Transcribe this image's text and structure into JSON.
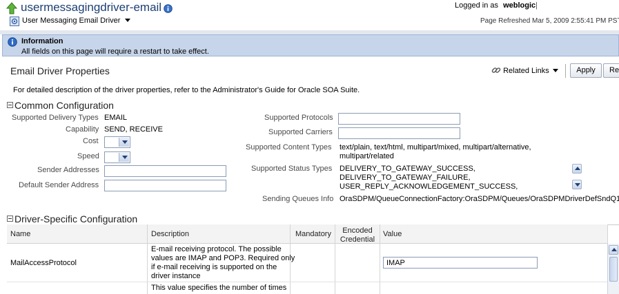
{
  "header": {
    "title": "usermessagingdriver-email",
    "menu_label": "User Messaging Email Driver",
    "logged_in_prefix": "Logged in as",
    "username": "weblogic",
    "refreshed": "Page Refreshed Mar 5, 2009 2:55:41 PM PST"
  },
  "info": {
    "title": "Information",
    "message": "All fields on this page will require a restart to take effect."
  },
  "page": {
    "title": "Email Driver Properties",
    "related_links": "Related Links",
    "apply": "Apply",
    "revert": "Re",
    "description": "For detailed description of the driver properties, refer to the Administrator's Guide for Oracle SOA Suite."
  },
  "common": {
    "title": "Common Configuration",
    "supported_delivery_types_label": "Supported Delivery Types",
    "supported_delivery_types": "EMAIL",
    "capability_label": "Capability",
    "capability": "SEND, RECEIVE",
    "cost_label": "Cost",
    "speed_label": "Speed",
    "sender_addresses_label": "Sender Addresses",
    "default_sender_label": "Default Sender Address",
    "supported_protocols_label": "Supported Protocols",
    "supported_carriers_label": "Supported Carriers",
    "content_types_label": "Supported Content Types",
    "content_types_line1": "text/plain, text/html, multipart/mixed, multipart/alternative,",
    "content_types_line2": "multipart/related",
    "status_types_label": "Supported Status Types",
    "status_types": [
      "DELIVERY_TO_GATEWAY_SUCCESS,",
      "DELIVERY_TO_GATEWAY_FAILURE,",
      "USER_REPLY_ACKNOWLEDGEMENT_SUCCESS,"
    ],
    "sending_queues_label": "Sending Queues Info",
    "sending_queues": "OraSDPM/QueueConnectionFactory:OraSDPM/Queues/OraSDPMDriverDefSndQ1"
  },
  "driver_specific": {
    "title": "Driver-Specific Configuration",
    "columns": {
      "name": "Name",
      "description": "Description",
      "mandatory": "Mandatory",
      "encoded_line1": "Encoded",
      "encoded_line2": "Credential",
      "value": "Value"
    },
    "rows": [
      {
        "name": "MailAccessProtocol",
        "description_lines": [
          "E-mail receiving protocol. The possible",
          "values are IMAP and POP3. Required only",
          "if e-mail receiving is supported on the",
          "driver instance"
        ],
        "value": "IMAP"
      },
      {
        "name": "",
        "description_lines": [
          "This value specifies the number of times"
        ],
        "value": ""
      }
    ]
  }
}
